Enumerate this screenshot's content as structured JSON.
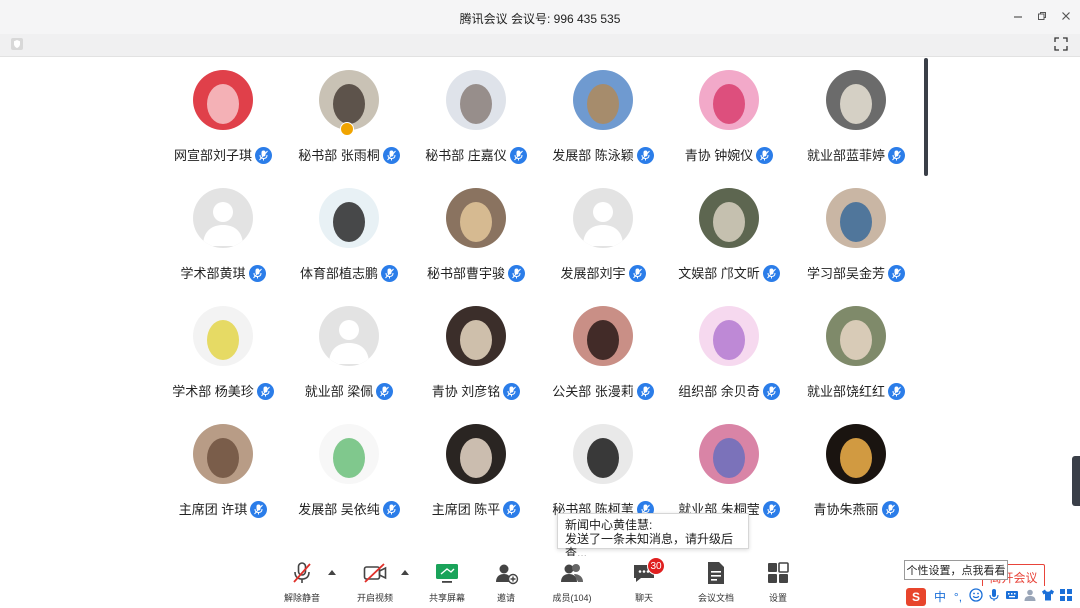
{
  "window": {
    "title_app": "腾讯会议",
    "title_meeting_label": "会议号:",
    "title_meeting_id": "996 435 535"
  },
  "participants": [
    {
      "name": "网宣部刘子琪",
      "bg": "#e0404a",
      "fg": "#f7c6c9"
    },
    {
      "name": "秘书部 张雨桐",
      "bg": "#c9c2b5",
      "fg": "#4a4038",
      "badge": true
    },
    {
      "name": "秘书部 庄嘉仪",
      "bg": "#dfe3ea",
      "fg": "#8b7f7a"
    },
    {
      "name": "发展部 陈泳颖",
      "bg": "#6f9ad0",
      "fg": "#b08a5a"
    },
    {
      "name": "青协 钟婉仪",
      "bg": "#f2a9c9",
      "fg": "#d94070"
    },
    {
      "name": "就业部蓝菲婷",
      "bg": "#6b6b6b",
      "fg": "#e8e2d5"
    },
    {
      "name": "学术部黄琪",
      "bg": "#e3e3e3",
      "fg": "#ffffff",
      "default": true
    },
    {
      "name": "体育部植志鹏",
      "bg": "#e8f1f5",
      "fg": "#2a2a2a"
    },
    {
      "name": "秘书部曹宇骏",
      "bg": "#8a7360",
      "fg": "#e3c79a"
    },
    {
      "name": "发展部刘宇",
      "bg": "#e3e3e3",
      "fg": "#ffffff",
      "default": true
    },
    {
      "name": "文娱部 邝文昕",
      "bg": "#5d6650",
      "fg": "#d7d0c0"
    },
    {
      "name": "学习部吴金芳",
      "bg": "#c9b6a4",
      "fg": "#3b6b9a"
    },
    {
      "name": "学术部 杨美珍",
      "bg": "#f3f3f3",
      "fg": "#e3d54a"
    },
    {
      "name": "就业部 梁佩",
      "bg": "#e3e3e3",
      "fg": "#ffffff",
      "default": true
    },
    {
      "name": "青协 刘彦铭",
      "bg": "#3b2e2a",
      "fg": "#e9d8c2"
    },
    {
      "name": "公关部 张漫莉",
      "bg": "#c98f86",
      "fg": "#2a1a18"
    },
    {
      "name": "组织部 余贝奇",
      "bg": "#f6d9ef",
      "fg": "#b47ad1"
    },
    {
      "name": "就业部饶红红",
      "bg": "#7f8a6a",
      "fg": "#e8d6c4"
    },
    {
      "name": "主席团 许琪",
      "bg": "#b89c86",
      "fg": "#6e5240"
    },
    {
      "name": "发展部 吴依纯",
      "bg": "#f7f7f7",
      "fg": "#6bbf7a"
    },
    {
      "name": "主席团 陈平",
      "bg": "#2a2522",
      "fg": "#e8d8c8"
    },
    {
      "name": "秘书部 陈柯苇",
      "bg": "#e9e9e9",
      "fg": "#1a1a1a"
    },
    {
      "name": "就业部 朱桐莹",
      "bg": "#d984a6",
      "fg": "#6a6fbd"
    },
    {
      "name": "青协朱燕丽",
      "bg": "#1a1410",
      "fg": "#f2b24a"
    }
  ],
  "notification": {
    "line1": "新闻中心黄佳慧:",
    "line2": "发送了一条未知消息，请升级后查..."
  },
  "toolbar": {
    "unmute": "解除静音",
    "start_video": "开启视频",
    "share_screen": "共享屏幕",
    "invite": "邀请",
    "members": "成员(104)",
    "chat": "聊天",
    "chat_count": "30",
    "docs": "会议文档",
    "settings": "设置",
    "leave": "离开会议"
  },
  "ime": {
    "tip": "个性设置，点我看看",
    "lang": "中",
    "punct": "°,",
    "logo": "S"
  },
  "colors": {
    "accent_blue": "#2b7de9",
    "leave_red": "#e8443a",
    "badge_red": "#e02020"
  }
}
